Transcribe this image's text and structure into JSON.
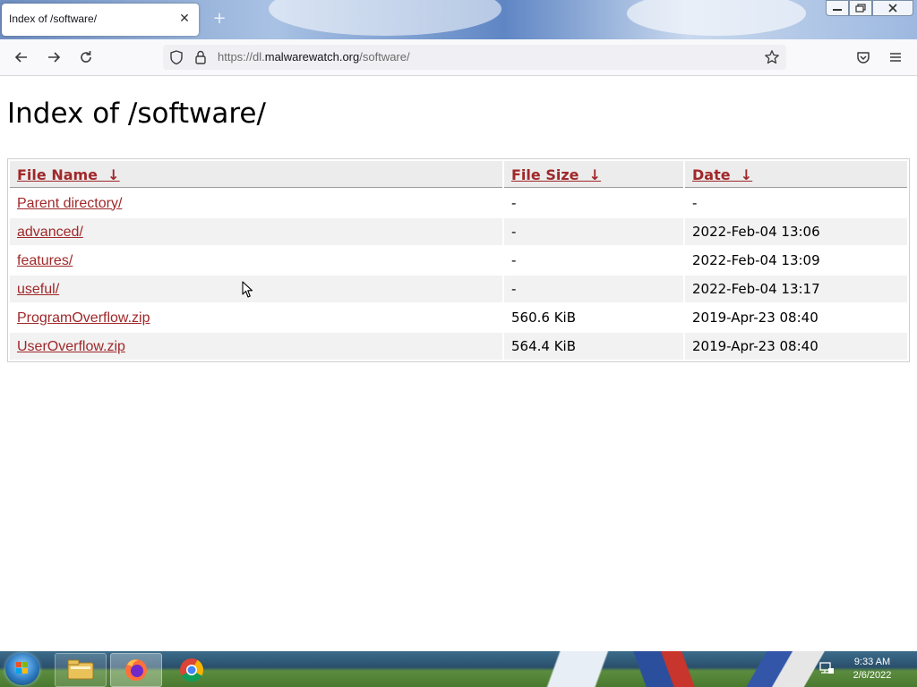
{
  "browser": {
    "tab_title": "Index of /software/",
    "tab_close_glyph": "✕",
    "new_tab_glyph": "+",
    "url_prefix": "https://dl.",
    "url_domain": "malwarewatch.org",
    "url_path": "/software/",
    "icons": [
      "back-arrow-icon",
      "forward-arrow-icon",
      "reload-icon",
      "shield-icon",
      "lock-icon",
      "star-bookmark-icon",
      "pocket-icon",
      "hamburger-menu-icon"
    ]
  },
  "page": {
    "heading": "Index of /software/",
    "columns": [
      {
        "label": "File Name",
        "arrow": "↓"
      },
      {
        "label": "File Size",
        "arrow": "↓"
      },
      {
        "label": "Date",
        "arrow": "↓"
      }
    ],
    "rows": [
      {
        "name": "Parent directory/",
        "size": "-",
        "date": "-"
      },
      {
        "name": "advanced/",
        "size": "-",
        "date": "2022-Feb-04 13:06"
      },
      {
        "name": "features/",
        "size": "-",
        "date": "2022-Feb-04 13:09"
      },
      {
        "name": "useful/",
        "size": "-",
        "date": "2022-Feb-04 13:17"
      },
      {
        "name": "ProgramOverflow.zip",
        "size": "560.6 KiB",
        "date": "2019-Apr-23 08:40"
      },
      {
        "name": "UserOverflow.zip",
        "size": "564.4 KiB",
        "date": "2019-Apr-23 08:40"
      }
    ],
    "link_color": "#a0282a"
  },
  "taskbar": {
    "time": "9:33 AM",
    "date": "2/6/2022",
    "apps": [
      "file-explorer-icon",
      "firefox-icon",
      "chrome-icon"
    ]
  }
}
